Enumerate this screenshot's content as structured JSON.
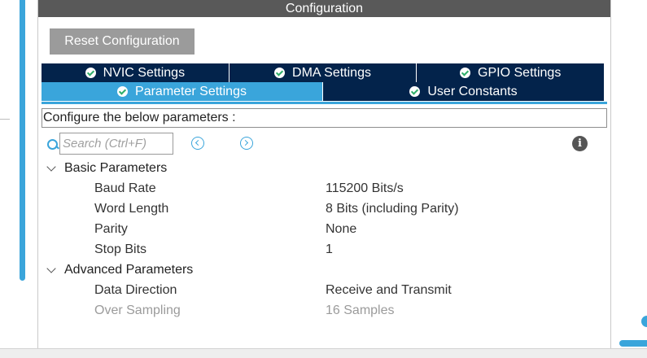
{
  "header": {
    "title": "Configuration"
  },
  "toolbar": {
    "reset_label": "Reset Configuration"
  },
  "tabs": {
    "row1": [
      {
        "label": "NVIC Settings",
        "icon": "check-circle-icon"
      },
      {
        "label": "DMA Settings",
        "icon": "check-circle-icon"
      },
      {
        "label": "GPIO Settings",
        "icon": "check-circle-icon"
      }
    ],
    "row2": [
      {
        "label": "Parameter Settings",
        "icon": "check-circle-icon",
        "active": true
      },
      {
        "label": "User Constants",
        "icon": "check-circle-icon"
      }
    ]
  },
  "config_label": "Configure the below parameters :",
  "search": {
    "placeholder": "Search (Ctrl+F)",
    "value": ""
  },
  "groups": [
    {
      "name": "Basic Parameters",
      "params": [
        {
          "name": "Baud Rate",
          "value": "115200 Bits/s"
        },
        {
          "name": "Word Length",
          "value": "8 Bits (including Parity)"
        },
        {
          "name": "Parity",
          "value": "None"
        },
        {
          "name": "Stop Bits",
          "value": "1"
        }
      ]
    },
    {
      "name": "Advanced Parameters",
      "params": [
        {
          "name": "Data Direction",
          "value": "Receive and Transmit"
        },
        {
          "name": "Over Sampling",
          "value": "16 Samples",
          "disabled": true
        }
      ]
    }
  ],
  "colors": {
    "accent": "#3aa5db",
    "tab_dark": "#03234b",
    "header_bg": "#595959",
    "button_bg": "#9b9b9b",
    "check": "#2fae6a"
  }
}
